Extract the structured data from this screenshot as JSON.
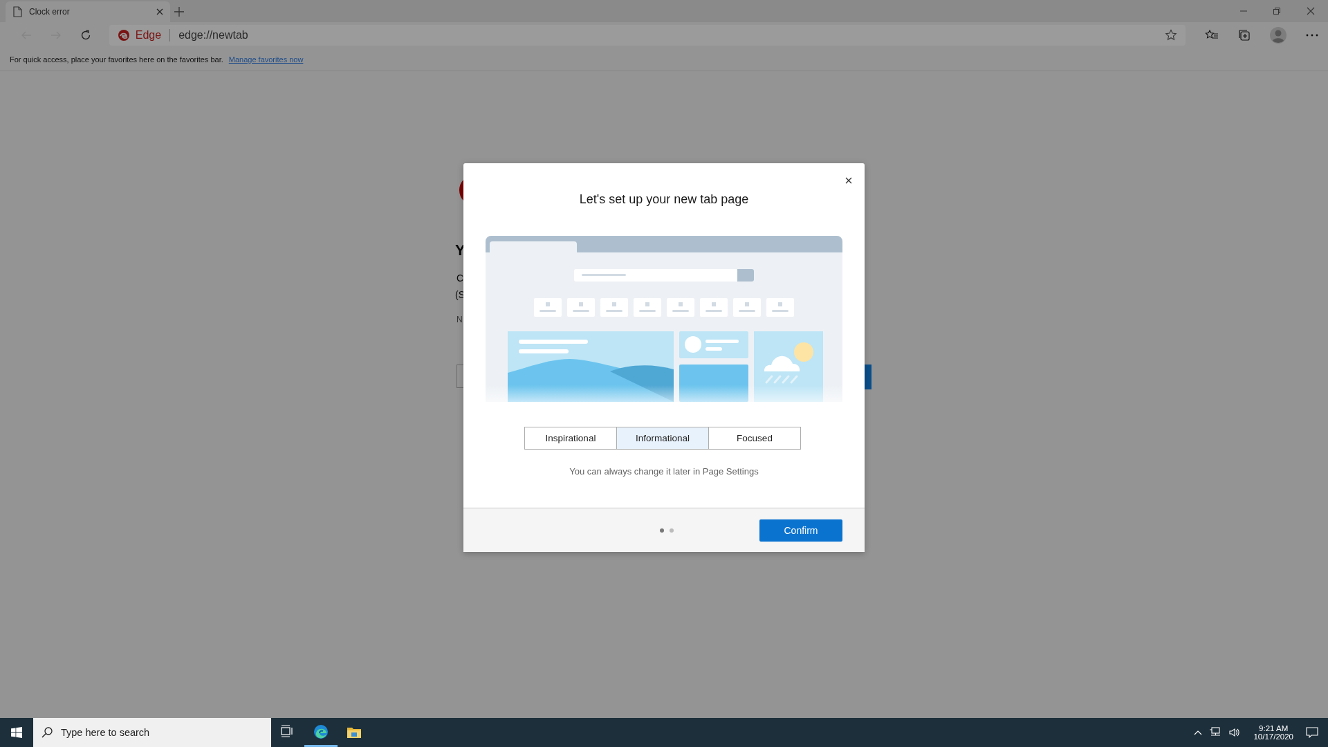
{
  "browser": {
    "tab": {
      "title": "Clock error"
    },
    "address": {
      "site_label": "Edge",
      "url": "edge://newtab"
    },
    "favorites_bar": {
      "message": "For quick access, place your favorites here on the favorites bar.",
      "link": "Manage favorites now"
    }
  },
  "background_page": {
    "texts": [
      "Y",
      "C",
      "(S",
      "N"
    ]
  },
  "dialog": {
    "title": "Let's set up your new tab page",
    "options": [
      {
        "label": "Inspirational",
        "selected": false
      },
      {
        "label": "Informational",
        "selected": true
      },
      {
        "label": "Focused",
        "selected": false
      }
    ],
    "note": "You can always change it later in Page Settings",
    "steps": [
      {
        "selected": true
      },
      {
        "selected": false
      }
    ],
    "confirm": "Confirm"
  },
  "taskbar": {
    "search_placeholder": "Type here to search",
    "apps": [
      {
        "kind": "task-view",
        "active": false
      },
      {
        "kind": "edge",
        "active": true
      },
      {
        "kind": "explorer",
        "active": false
      }
    ],
    "time": "9:21 AM",
    "date": "10/17/2020"
  }
}
